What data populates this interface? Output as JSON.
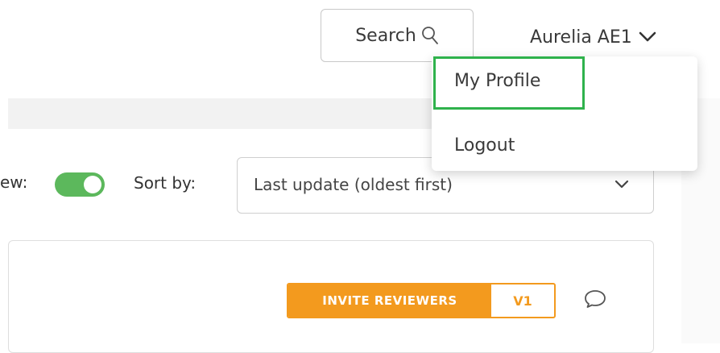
{
  "header": {
    "search_label": "Search",
    "user_name": "Aurelia AE1"
  },
  "user_dropdown": {
    "items": [
      {
        "label": "My Profile",
        "highlighted": true
      },
      {
        "label": "Logout"
      }
    ],
    "highlight_color": "#2fb24c"
  },
  "toolbar": {
    "view_label": "ew:",
    "view_toggle_on": true,
    "toggle_color": "#5cb85c",
    "sort_label": "Sort by:",
    "sort_value": "Last update (oldest first)"
  },
  "card": {
    "invite_label": "INVITE REVIEWERS",
    "version": "V1",
    "accent_color": "#f39a1e",
    "comment_icon": "comment-icon"
  }
}
